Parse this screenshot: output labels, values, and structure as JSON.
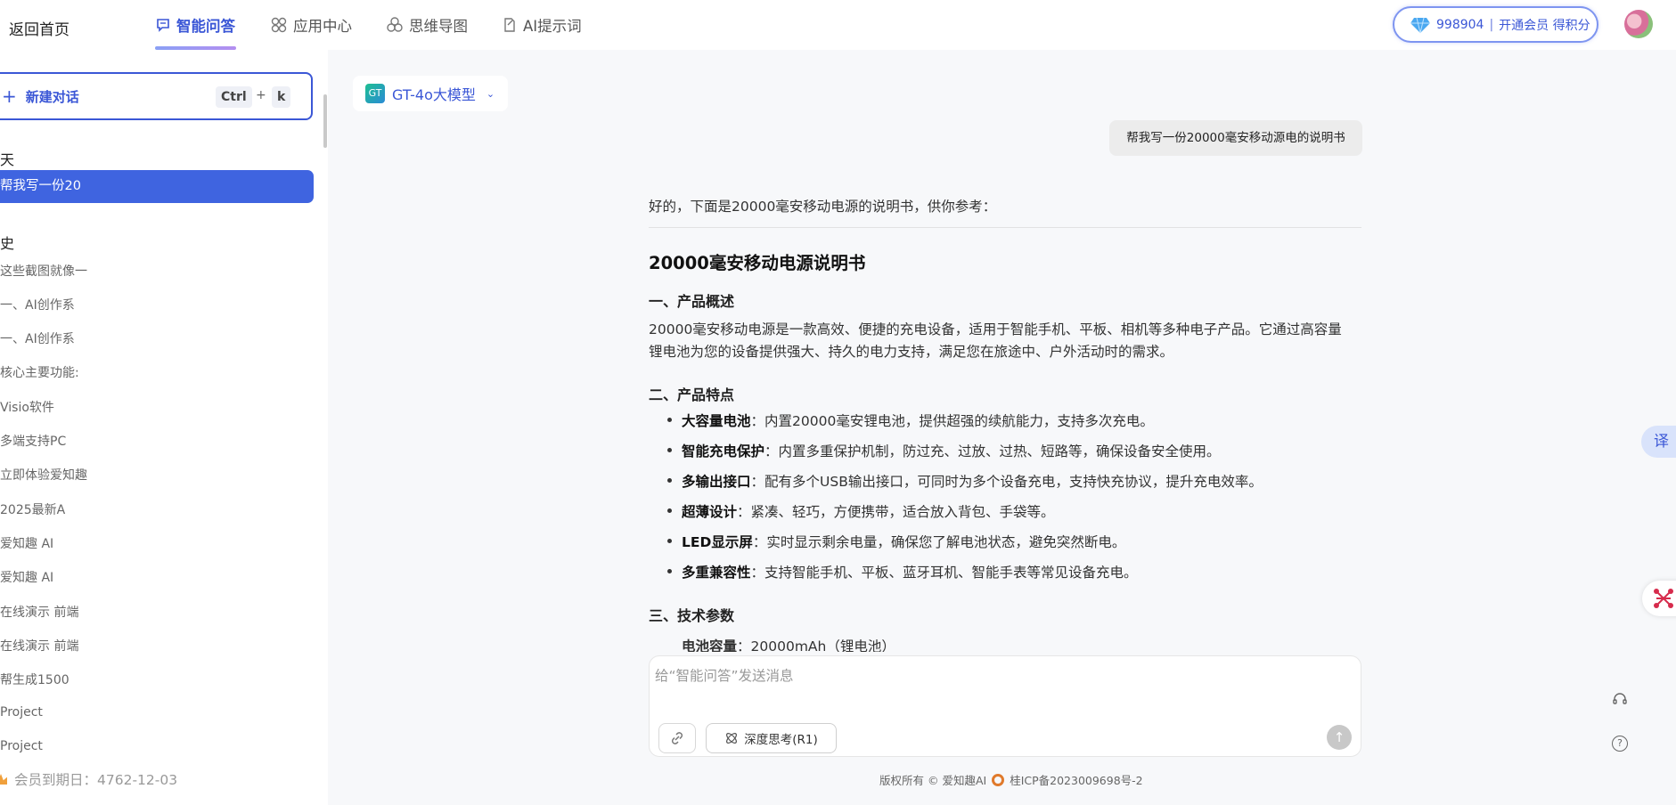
{
  "nav": {
    "back": "返回首页",
    "tabs": [
      {
        "label": "智能问答",
        "icon": "chat-bubble-icon"
      },
      {
        "label": "应用中心",
        "icon": "app-grid-icon"
      },
      {
        "label": "思维导图",
        "icon": "mindmap-icon"
      },
      {
        "label": "AI提示词",
        "icon": "prompt-edit-icon"
      }
    ],
    "points_value": "998904",
    "points_sep": "|",
    "points_action": "开通会员 得积分"
  },
  "sidebar": {
    "new_chat": "新建对话",
    "kbd_ctrl": "Ctrl",
    "kbd_plus": "+",
    "kbd_k": "k",
    "today_heading": "天",
    "active_item": "帮我写一份20",
    "history_heading": "史",
    "history": [
      "这些截图就像一",
      "一、AI创作系",
      "一、AI创作系",
      "核心主要功能:",
      "Visio软件",
      "多端支持PC",
      "立即体验爱知趣",
      "2025最新A",
      "爱知趣 AI",
      "爱知趣 AI",
      "在线演示 前端",
      "在线演示 前端",
      "帮生成1500",
      "Project",
      "Project"
    ],
    "member_expiry": "会员到期日：4762-12-03"
  },
  "chat": {
    "model": "GT-4o大模型",
    "model_logo": "GT",
    "user_message": "帮我写一份20000毫安移动源电的说明书",
    "intro": "好的，下面是20000毫安移动电源的说明书，供你参考：",
    "title": "20000毫安移动电源说明书",
    "section1": "一、产品概述",
    "overview_line1": "20000毫安移动电源是一款高效、便捷的充电设备，适用于智能手机、平板、相机等多种电子产品。它通过高容量",
    "overview_line2": "锂电池为您的设备提供强大、持久的电力支持，满足您在旅途中、户外活动时的需求。",
    "section2": "二、产品特点",
    "features": [
      {
        "name": "大容量电池",
        "desc": "：内置20000毫安锂电池，提供超强的续航能力，支持多次充电。"
      },
      {
        "name": "智能充电保护",
        "desc": "：内置多重保护机制，防过充、过放、过热、短路等，确保设备安全使用。"
      },
      {
        "name": "多输出接口",
        "desc": "：配有多个USB输出接口，可同时为多个设备充电，支持快充协议，提升充电效率。"
      },
      {
        "name": "超薄设计",
        "desc": "：紧凑、轻巧，方便携带，适合放入背包、手袋等。"
      },
      {
        "name": "LED显示屏",
        "desc": "：实时显示剩余电量，确保您了解电池状态，避免突然断电。"
      },
      {
        "name": "多重兼容性",
        "desc": "：支持智能手机、平板、蓝牙耳机、智能手表等常见设备充电。"
      }
    ],
    "section3": "三、技术参数",
    "param_name": "电池容量",
    "param_value": "：20000mAh（锂电池）",
    "input_placeholder": "给“智能问答”发送消息",
    "deep_think": "深度思考(R1)"
  },
  "footer": {
    "copyright": "版权所有 © 爱知趣AI",
    "icp": "桂ICP备2023009698号-2"
  },
  "widgets": {
    "translate": "译",
    "help": "?"
  }
}
